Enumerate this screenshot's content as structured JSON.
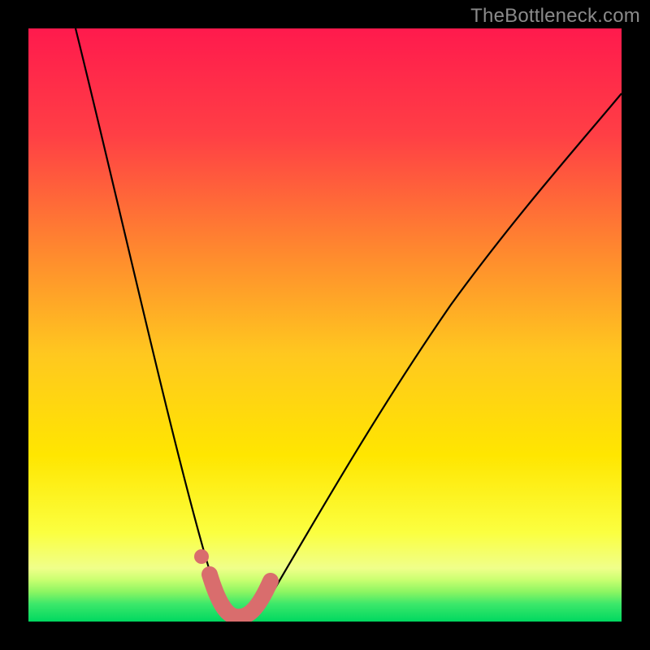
{
  "watermark": "TheBottleneck.com",
  "chart_data": {
    "type": "line",
    "title": "",
    "xlabel": "",
    "ylabel": "",
    "xlim": [
      0,
      100
    ],
    "ylim": [
      0,
      100
    ],
    "grid": false,
    "legend": false,
    "background_gradient": {
      "top": "#ff1a4d",
      "mid_upper": "#ff7a2e",
      "mid": "#ffe600",
      "mid_lower": "#f8ff66",
      "green_band_top": "#d6ff66",
      "green_band_bottom": "#00e060"
    },
    "series": [
      {
        "name": "curve-line",
        "stroke": "#000000",
        "stroke_width": 2,
        "x": [
          8,
          10,
          12,
          14,
          16,
          18,
          20,
          22,
          24,
          26,
          28,
          30,
          32,
          33,
          34,
          35,
          36,
          37,
          38,
          40,
          42,
          44,
          46,
          50,
          55,
          60,
          65,
          70,
          75,
          80,
          85,
          90,
          95,
          100
        ],
        "y": [
          100,
          92,
          84,
          76,
          68,
          60,
          52,
          44,
          36,
          28,
          21,
          14,
          7,
          3,
          0.5,
          0,
          0,
          0.5,
          2,
          6,
          11,
          16,
          21,
          30,
          40,
          48,
          55,
          62,
          68,
          73,
          78,
          82,
          86,
          89
        ]
      },
      {
        "name": "dot-marker",
        "type": "scatter",
        "color": "#d96d6d",
        "x": [
          29.5
        ],
        "y": [
          11
        ],
        "r": 1.2
      },
      {
        "name": "trough-band",
        "stroke": "#d96d6d",
        "stroke_width": 4,
        "x": [
          31,
          32,
          33,
          34,
          35,
          36,
          37,
          38,
          39,
          40,
          41
        ],
        "y": [
          7,
          4,
          2,
          1,
          0.5,
          0.5,
          0.8,
          1.8,
          3.5,
          5.5,
          8
        ]
      }
    ]
  }
}
